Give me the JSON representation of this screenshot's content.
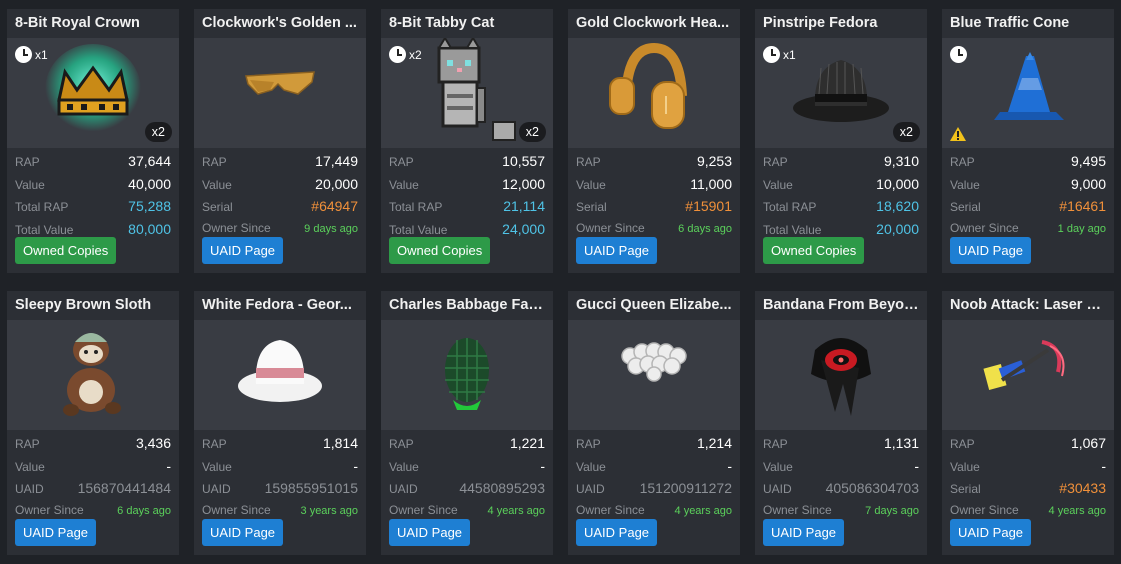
{
  "colors": {
    "background": "#1f2227",
    "card": "#2c2f35",
    "thumb": "#393c43",
    "blue_value": "#4fc3e6",
    "orange_value": "#f0903a",
    "green_value": "#5bd15b",
    "btn_green": "#2d9a48",
    "btn_blue": "#1e7fd3"
  },
  "cards": [
    {
      "title": "8-Bit Royal Crown",
      "icon": "royal-crown-icon",
      "clock": true,
      "clock_label": "x1",
      "count": "x2",
      "warning": false,
      "stats": [
        {
          "label": "RAP",
          "value": "37,644",
          "color": "white"
        },
        {
          "label": "Value",
          "value": "40,000",
          "color": "white"
        },
        {
          "label": "Total RAP",
          "value": "75,288",
          "color": "blue"
        },
        {
          "label": "Total Value",
          "value": "80,000",
          "color": "blue"
        }
      ],
      "button": {
        "label": "Owned Copies",
        "color": "green"
      }
    },
    {
      "title": "Clockwork's Golden ...",
      "icon": "golden-shades-icon",
      "clock": false,
      "clock_label": "",
      "count": "",
      "warning": false,
      "stats": [
        {
          "label": "RAP",
          "value": "17,449",
          "color": "white"
        },
        {
          "label": "Value",
          "value": "20,000",
          "color": "white"
        },
        {
          "label": "Serial",
          "value": "#64947",
          "color": "orange"
        },
        {
          "label": "Owner Since",
          "value": "9 days ago",
          "color": "green"
        }
      ],
      "button": {
        "label": "UAID Page",
        "color": "blue"
      }
    },
    {
      "title": "8-Bit Tabby Cat",
      "icon": "tabby-cat-icon",
      "clock": true,
      "clock_label": "x2",
      "count": "x2",
      "warning": false,
      "stats": [
        {
          "label": "RAP",
          "value": "10,557",
          "color": "white"
        },
        {
          "label": "Value",
          "value": "12,000",
          "color": "white"
        },
        {
          "label": "Total RAP",
          "value": "21,114",
          "color": "blue"
        },
        {
          "label": "Total Value",
          "value": "24,000",
          "color": "blue"
        }
      ],
      "button": {
        "label": "Owned Copies",
        "color": "green"
      }
    },
    {
      "title": "Gold Clockwork Hea...",
      "icon": "gold-headphones-icon",
      "clock": false,
      "clock_label": "",
      "count": "",
      "warning": false,
      "stats": [
        {
          "label": "RAP",
          "value": "9,253",
          "color": "white"
        },
        {
          "label": "Value",
          "value": "11,000",
          "color": "white"
        },
        {
          "label": "Serial",
          "value": "#15901",
          "color": "orange"
        },
        {
          "label": "Owner Since",
          "value": "6 days ago",
          "color": "green"
        }
      ],
      "button": {
        "label": "UAID Page",
        "color": "blue"
      }
    },
    {
      "title": "Pinstripe Fedora",
      "icon": "pinstripe-fedora-icon",
      "clock": true,
      "clock_label": "x1",
      "count": "x2",
      "warning": false,
      "stats": [
        {
          "label": "RAP",
          "value": "9,310",
          "color": "white"
        },
        {
          "label": "Value",
          "value": "10,000",
          "color": "white"
        },
        {
          "label": "Total RAP",
          "value": "18,620",
          "color": "blue"
        },
        {
          "label": "Total Value",
          "value": "20,000",
          "color": "blue"
        }
      ],
      "button": {
        "label": "Owned Copies",
        "color": "green"
      }
    },
    {
      "title": "Blue Traffic Cone",
      "icon": "traffic-cone-icon",
      "clock": true,
      "clock_label": "",
      "count": "",
      "warning": true,
      "stats": [
        {
          "label": "RAP",
          "value": "9,495",
          "color": "white"
        },
        {
          "label": "Value",
          "value": "9,000",
          "color": "white"
        },
        {
          "label": "Serial",
          "value": "#16461",
          "color": "orange"
        },
        {
          "label": "Owner Since",
          "value": "1 day ago",
          "color": "green"
        }
      ],
      "button": {
        "label": "UAID Page",
        "color": "blue"
      }
    },
    {
      "title": "Sleepy Brown Sloth",
      "icon": "sloth-icon",
      "clock": false,
      "clock_label": "",
      "count": "",
      "warning": false,
      "stats": [
        {
          "label": "RAP",
          "value": "3,436",
          "color": "white"
        },
        {
          "label": "Value",
          "value": "-",
          "color": "white"
        },
        {
          "label": "UAID",
          "value": "156870441484",
          "color": "gray"
        },
        {
          "label": "Owner Since",
          "value": "6 days ago",
          "color": "green"
        }
      ],
      "button": {
        "label": "UAID Page",
        "color": "blue"
      }
    },
    {
      "title": "White Fedora - Geor...",
      "icon": "white-fedora-icon",
      "clock": false,
      "clock_label": "",
      "count": "",
      "warning": false,
      "stats": [
        {
          "label": "RAP",
          "value": "1,814",
          "color": "white"
        },
        {
          "label": "Value",
          "value": "-",
          "color": "white"
        },
        {
          "label": "UAID",
          "value": "159855951015",
          "color": "gray"
        },
        {
          "label": "Owner Since",
          "value": "3 years ago",
          "color": "green"
        }
      ],
      "button": {
        "label": "UAID Page",
        "color": "blue"
      }
    },
    {
      "title": "Charles Babbage Fab...",
      "icon": "green-egg-icon",
      "clock": false,
      "clock_label": "",
      "count": "",
      "warning": false,
      "stats": [
        {
          "label": "RAP",
          "value": "1,221",
          "color": "white"
        },
        {
          "label": "Value",
          "value": "-",
          "color": "white"
        },
        {
          "label": "UAID",
          "value": "44580895293",
          "color": "gray"
        },
        {
          "label": "Owner Since",
          "value": "4 years ago",
          "color": "green"
        }
      ],
      "button": {
        "label": "UAID Page",
        "color": "blue"
      }
    },
    {
      "title": "Gucci Queen Elizabe...",
      "icon": "ruff-collar-icon",
      "clock": false,
      "clock_label": "",
      "count": "",
      "warning": false,
      "stats": [
        {
          "label": "RAP",
          "value": "1,214",
          "color": "white"
        },
        {
          "label": "Value",
          "value": "-",
          "color": "white"
        },
        {
          "label": "UAID",
          "value": "151200911272",
          "color": "gray"
        },
        {
          "label": "Owner Since",
          "value": "4 years ago",
          "color": "green"
        }
      ],
      "button": {
        "label": "UAID Page",
        "color": "blue"
      }
    },
    {
      "title": "Bandana From Beyond",
      "icon": "bandana-icon",
      "clock": false,
      "clock_label": "",
      "count": "",
      "warning": false,
      "stats": [
        {
          "label": "RAP",
          "value": "1,131",
          "color": "white"
        },
        {
          "label": "Value",
          "value": "-",
          "color": "white"
        },
        {
          "label": "UAID",
          "value": "405086304703",
          "color": "gray"
        },
        {
          "label": "Owner Since",
          "value": "7 days ago",
          "color": "green"
        }
      ],
      "button": {
        "label": "UAID Page",
        "color": "blue"
      }
    },
    {
      "title": "Noob Attack: Laser S...",
      "icon": "laser-scythe-icon",
      "clock": false,
      "clock_label": "",
      "count": "",
      "warning": false,
      "stats": [
        {
          "label": "RAP",
          "value": "1,067",
          "color": "white"
        },
        {
          "label": "Value",
          "value": "-",
          "color": "white"
        },
        {
          "label": "Serial",
          "value": "#30433",
          "color": "orange"
        },
        {
          "label": "Owner Since",
          "value": "4 years ago",
          "color": "green"
        }
      ],
      "button": {
        "label": "UAID Page",
        "color": "blue"
      }
    }
  ]
}
